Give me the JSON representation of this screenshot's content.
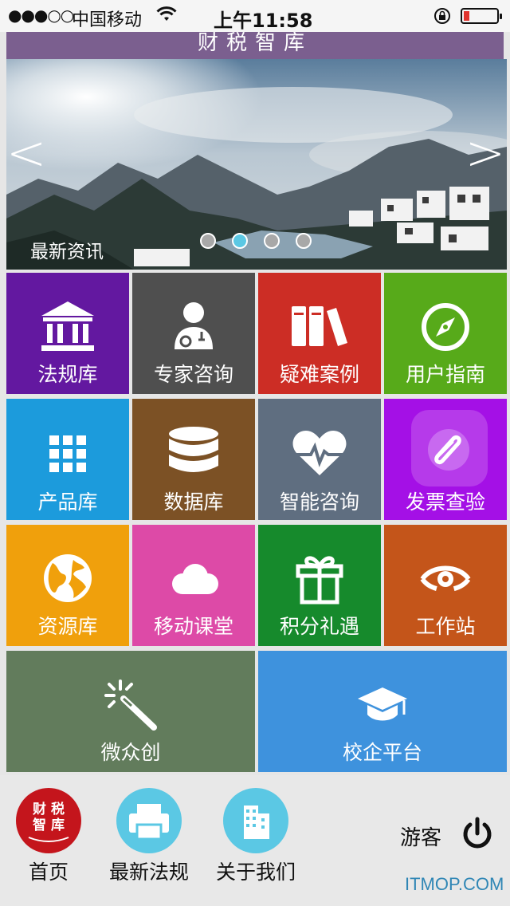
{
  "status_bar": {
    "signal": "●●●○○",
    "carrier": "中国移动",
    "time": "上午11:58"
  },
  "header": {
    "title": "财税智库"
  },
  "banner": {
    "caption": "最新资讯",
    "prev_arrow": "<",
    "next_arrow": ">",
    "pages": 4,
    "active_page": 2
  },
  "tiles": [
    {
      "label": "法规库",
      "icon": "bank-icon",
      "color": "#6318a0"
    },
    {
      "label": "专家咨询",
      "icon": "doctor-icon",
      "color": "#4f4f4f"
    },
    {
      "label": "疑难案例",
      "icon": "books-icon",
      "color": "#cc2d25"
    },
    {
      "label": "用户指南",
      "icon": "compass-icon",
      "color": "#57aa1a"
    },
    {
      "label": "产品库",
      "icon": "grid-icon",
      "color": "#1c9bdc"
    },
    {
      "label": "数据库",
      "icon": "database-icon",
      "color": "#7c5125"
    },
    {
      "label": "智能咨询",
      "icon": "heartbeat-icon",
      "color": "#5f6e80"
    },
    {
      "label": "发票查验",
      "icon": "paperclip-icon",
      "color": "#a410e6"
    },
    {
      "label": "资源库",
      "icon": "globe-icon",
      "color": "#f0a00c"
    },
    {
      "label": "移动课堂",
      "icon": "cloud-icon",
      "color": "#dd4aa7"
    },
    {
      "label": "积分礼遇",
      "icon": "gift-icon",
      "color": "#168a2c"
    },
    {
      "label": "工作站",
      "icon": "eye-icon",
      "color": "#c4551a"
    },
    {
      "label": "微众创",
      "icon": "magic-wand-icon",
      "color": "#627c5c"
    },
    {
      "label": "校企平台",
      "icon": "graduation-cap-icon",
      "color": "#3e92dd"
    }
  ],
  "tabbar": {
    "items": [
      {
        "label": "首页",
        "icon": "logo-icon",
        "logo_text": "财税智库"
      },
      {
        "label": "最新法规",
        "icon": "printer-icon"
      },
      {
        "label": "关于我们",
        "icon": "building-icon"
      }
    ],
    "user": "游客"
  },
  "watermark": "ITMOP.COM"
}
